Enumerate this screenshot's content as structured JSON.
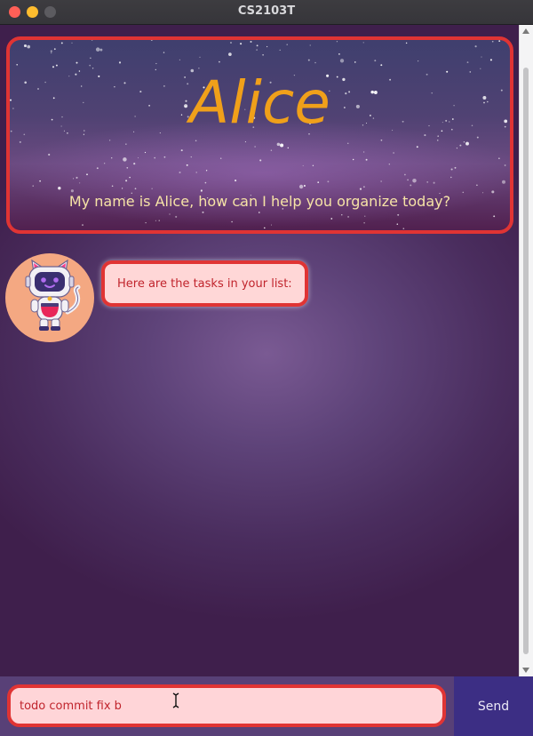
{
  "window": {
    "title": "CS2103T"
  },
  "header": {
    "title": "Alice",
    "subtitle": "My name is Alice, how can I help you organize today?"
  },
  "messages": [
    {
      "sender": "bot",
      "avatar_icon": "robot-cat-icon",
      "text": "Here are the tasks in your list:"
    }
  ],
  "input": {
    "value": "todo commit fix b",
    "placeholder": ""
  },
  "send_button": {
    "label": "Send"
  },
  "colors": {
    "accent_border": "#e03434",
    "bubble_bg": "#ffd7d7",
    "bubble_text": "#c0242c",
    "title_text": "#f0a01a",
    "subtitle_text": "#f6e3a6",
    "send_bg": "#3c2e84",
    "avatar_bg": "#f4a882"
  }
}
